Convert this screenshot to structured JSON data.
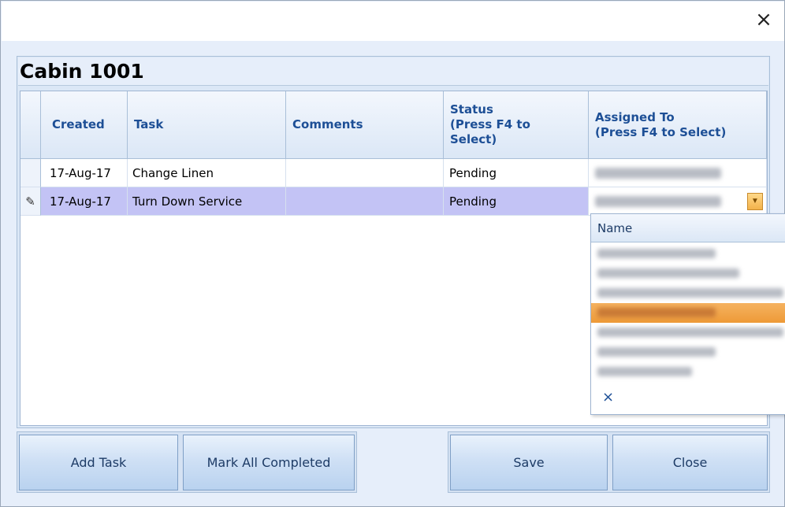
{
  "window": {
    "close_icon": "close-icon"
  },
  "cabin": {
    "title": "Cabin 1001"
  },
  "grid": {
    "headers": {
      "created": "Created",
      "task": "Task",
      "comments": "Comments",
      "status": "Status\n(Press F4 to\nSelect)",
      "assigned": "Assigned To\n(Press F4 to Select)"
    },
    "rows": [
      {
        "created": "17-Aug-17",
        "task": "Change Linen",
        "comments": "",
        "status": "Pending",
        "assigned": ""
      },
      {
        "created": "17-Aug-17",
        "task": "Turn Down Service",
        "comments": "",
        "status": "Pending",
        "assigned": "",
        "editing_icon": "pencil-icon"
      }
    ],
    "row_indicator_glyph": "✎"
  },
  "assign_dropdown": {
    "header": "Name",
    "selected_index": 3,
    "clear_label": "×",
    "button_glyph": "▼"
  },
  "buttons": {
    "add_task": "Add Task",
    "mark_all_completed": "Mark All Completed",
    "save": "Save",
    "close": "Close"
  },
  "colors": {
    "selected_row": "#c3c3f5",
    "header_text": "#1d4f96",
    "highlight": "#ee9a37"
  }
}
